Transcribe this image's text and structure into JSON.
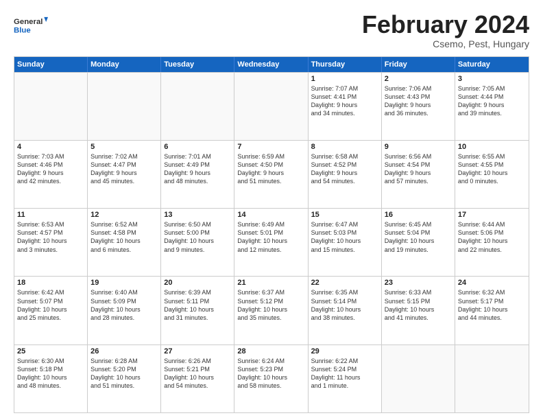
{
  "logo": {
    "line1": "General",
    "line2": "Blue"
  },
  "title": "February 2024",
  "subtitle": "Csemo, Pest, Hungary",
  "header_days": [
    "Sunday",
    "Monday",
    "Tuesday",
    "Wednesday",
    "Thursday",
    "Friday",
    "Saturday"
  ],
  "weeks": [
    [
      {
        "day": "",
        "info": ""
      },
      {
        "day": "",
        "info": ""
      },
      {
        "day": "",
        "info": ""
      },
      {
        "day": "",
        "info": ""
      },
      {
        "day": "1",
        "info": "Sunrise: 7:07 AM\nSunset: 4:41 PM\nDaylight: 9 hours\nand 34 minutes."
      },
      {
        "day": "2",
        "info": "Sunrise: 7:06 AM\nSunset: 4:43 PM\nDaylight: 9 hours\nand 36 minutes."
      },
      {
        "day": "3",
        "info": "Sunrise: 7:05 AM\nSunset: 4:44 PM\nDaylight: 9 hours\nand 39 minutes."
      }
    ],
    [
      {
        "day": "4",
        "info": "Sunrise: 7:03 AM\nSunset: 4:46 PM\nDaylight: 9 hours\nand 42 minutes."
      },
      {
        "day": "5",
        "info": "Sunrise: 7:02 AM\nSunset: 4:47 PM\nDaylight: 9 hours\nand 45 minutes."
      },
      {
        "day": "6",
        "info": "Sunrise: 7:01 AM\nSunset: 4:49 PM\nDaylight: 9 hours\nand 48 minutes."
      },
      {
        "day": "7",
        "info": "Sunrise: 6:59 AM\nSunset: 4:50 PM\nDaylight: 9 hours\nand 51 minutes."
      },
      {
        "day": "8",
        "info": "Sunrise: 6:58 AM\nSunset: 4:52 PM\nDaylight: 9 hours\nand 54 minutes."
      },
      {
        "day": "9",
        "info": "Sunrise: 6:56 AM\nSunset: 4:54 PM\nDaylight: 9 hours\nand 57 minutes."
      },
      {
        "day": "10",
        "info": "Sunrise: 6:55 AM\nSunset: 4:55 PM\nDaylight: 10 hours\nand 0 minutes."
      }
    ],
    [
      {
        "day": "11",
        "info": "Sunrise: 6:53 AM\nSunset: 4:57 PM\nDaylight: 10 hours\nand 3 minutes."
      },
      {
        "day": "12",
        "info": "Sunrise: 6:52 AM\nSunset: 4:58 PM\nDaylight: 10 hours\nand 6 minutes."
      },
      {
        "day": "13",
        "info": "Sunrise: 6:50 AM\nSunset: 5:00 PM\nDaylight: 10 hours\nand 9 minutes."
      },
      {
        "day": "14",
        "info": "Sunrise: 6:49 AM\nSunset: 5:01 PM\nDaylight: 10 hours\nand 12 minutes."
      },
      {
        "day": "15",
        "info": "Sunrise: 6:47 AM\nSunset: 5:03 PM\nDaylight: 10 hours\nand 15 minutes."
      },
      {
        "day": "16",
        "info": "Sunrise: 6:45 AM\nSunset: 5:04 PM\nDaylight: 10 hours\nand 19 minutes."
      },
      {
        "day": "17",
        "info": "Sunrise: 6:44 AM\nSunset: 5:06 PM\nDaylight: 10 hours\nand 22 minutes."
      }
    ],
    [
      {
        "day": "18",
        "info": "Sunrise: 6:42 AM\nSunset: 5:07 PM\nDaylight: 10 hours\nand 25 minutes."
      },
      {
        "day": "19",
        "info": "Sunrise: 6:40 AM\nSunset: 5:09 PM\nDaylight: 10 hours\nand 28 minutes."
      },
      {
        "day": "20",
        "info": "Sunrise: 6:39 AM\nSunset: 5:11 PM\nDaylight: 10 hours\nand 31 minutes."
      },
      {
        "day": "21",
        "info": "Sunrise: 6:37 AM\nSunset: 5:12 PM\nDaylight: 10 hours\nand 35 minutes."
      },
      {
        "day": "22",
        "info": "Sunrise: 6:35 AM\nSunset: 5:14 PM\nDaylight: 10 hours\nand 38 minutes."
      },
      {
        "day": "23",
        "info": "Sunrise: 6:33 AM\nSunset: 5:15 PM\nDaylight: 10 hours\nand 41 minutes."
      },
      {
        "day": "24",
        "info": "Sunrise: 6:32 AM\nSunset: 5:17 PM\nDaylight: 10 hours\nand 44 minutes."
      }
    ],
    [
      {
        "day": "25",
        "info": "Sunrise: 6:30 AM\nSunset: 5:18 PM\nDaylight: 10 hours\nand 48 minutes."
      },
      {
        "day": "26",
        "info": "Sunrise: 6:28 AM\nSunset: 5:20 PM\nDaylight: 10 hours\nand 51 minutes."
      },
      {
        "day": "27",
        "info": "Sunrise: 6:26 AM\nSunset: 5:21 PM\nDaylight: 10 hours\nand 54 minutes."
      },
      {
        "day": "28",
        "info": "Sunrise: 6:24 AM\nSunset: 5:23 PM\nDaylight: 10 hours\nand 58 minutes."
      },
      {
        "day": "29",
        "info": "Sunrise: 6:22 AM\nSunset: 5:24 PM\nDaylight: 11 hours\nand 1 minute."
      },
      {
        "day": "",
        "info": ""
      },
      {
        "day": "",
        "info": ""
      }
    ]
  ]
}
